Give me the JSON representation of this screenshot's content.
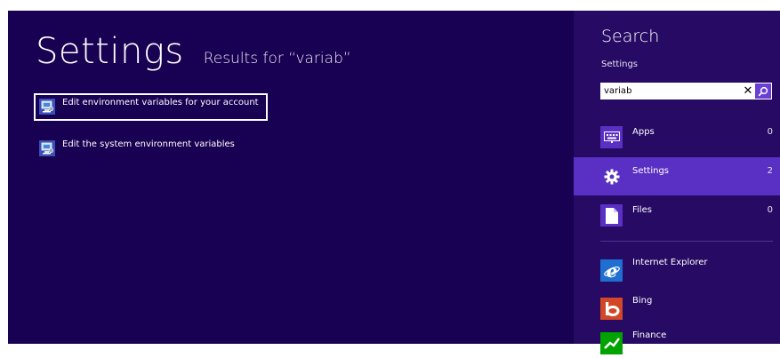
{
  "main": {
    "title": "Settings",
    "subtitle": "Results for “variab”",
    "results": [
      {
        "label": "Edit environment variables for your account",
        "icon": "system-properties-icon",
        "selected": true
      },
      {
        "label": "Edit the system environment variables",
        "icon": "system-properties-icon",
        "selected": false
      }
    ]
  },
  "search_pane": {
    "title": "Search",
    "scope": "Settings",
    "query": "variab",
    "clear_glyph": "✕",
    "categories": [
      {
        "label": "Apps",
        "count": "0",
        "icon": "apps-keyboard-icon",
        "active": false
      },
      {
        "label": "Settings",
        "count": "2",
        "icon": "settings-gear-icon",
        "active": true
      },
      {
        "label": "Files",
        "count": "0",
        "icon": "file-icon",
        "active": false
      }
    ],
    "apps": [
      {
        "label": "Internet Explorer",
        "icon": "internet-explorer-icon",
        "tile_color": "#1f6fd1"
      },
      {
        "label": "Bing",
        "icon": "bing-icon",
        "tile_color": "#d24726"
      },
      {
        "label": "Finance",
        "icon": "finance-icon",
        "tile_color": "#00a300"
      }
    ]
  },
  "colors": {
    "main_bg": "#180052",
    "pane_bg": "#260a63",
    "accent": "#5a30c4",
    "search_button": "#6b3fd6"
  }
}
